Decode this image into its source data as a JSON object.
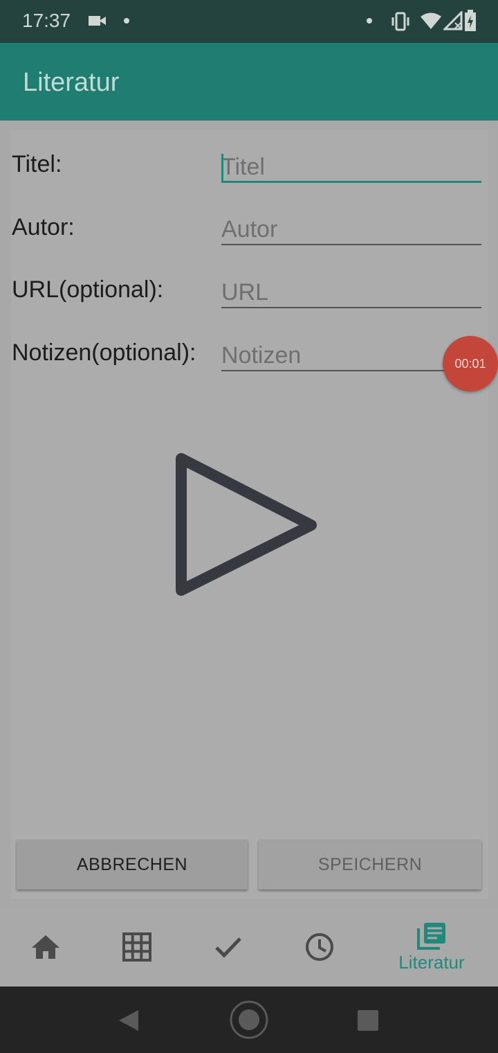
{
  "status_bar": {
    "time": "17:37",
    "icons": [
      "video-camera-icon",
      "dot-icon",
      "dot-icon",
      "vibrate-icon",
      "wifi-icon",
      "signal-icon",
      "battery-icon"
    ]
  },
  "app_bar": {
    "title": "Literatur"
  },
  "form": {
    "title_label": "Titel:",
    "title_placeholder": "Titel",
    "author_label": "Autor:",
    "author_placeholder": "Autor",
    "url_label": "URL(optional):",
    "url_placeholder": "URL",
    "notes_label": "Notizen(optional):",
    "notes_placeholder": "Notizen"
  },
  "recording_badge": {
    "text": "00:01"
  },
  "buttons": {
    "cancel": "ABBRECHEN",
    "save": "SPEICHERN"
  },
  "bottom_nav": {
    "items": [
      {
        "icon": "home-icon"
      },
      {
        "icon": "grid-icon"
      },
      {
        "icon": "check-icon"
      },
      {
        "icon": "clock-icon"
      },
      {
        "icon": "literature-icon",
        "label": "Literatur",
        "active": true
      }
    ]
  },
  "colors": {
    "accent": "#1f8a7c",
    "app_bar": "#207d72",
    "record": "#c4453a"
  }
}
